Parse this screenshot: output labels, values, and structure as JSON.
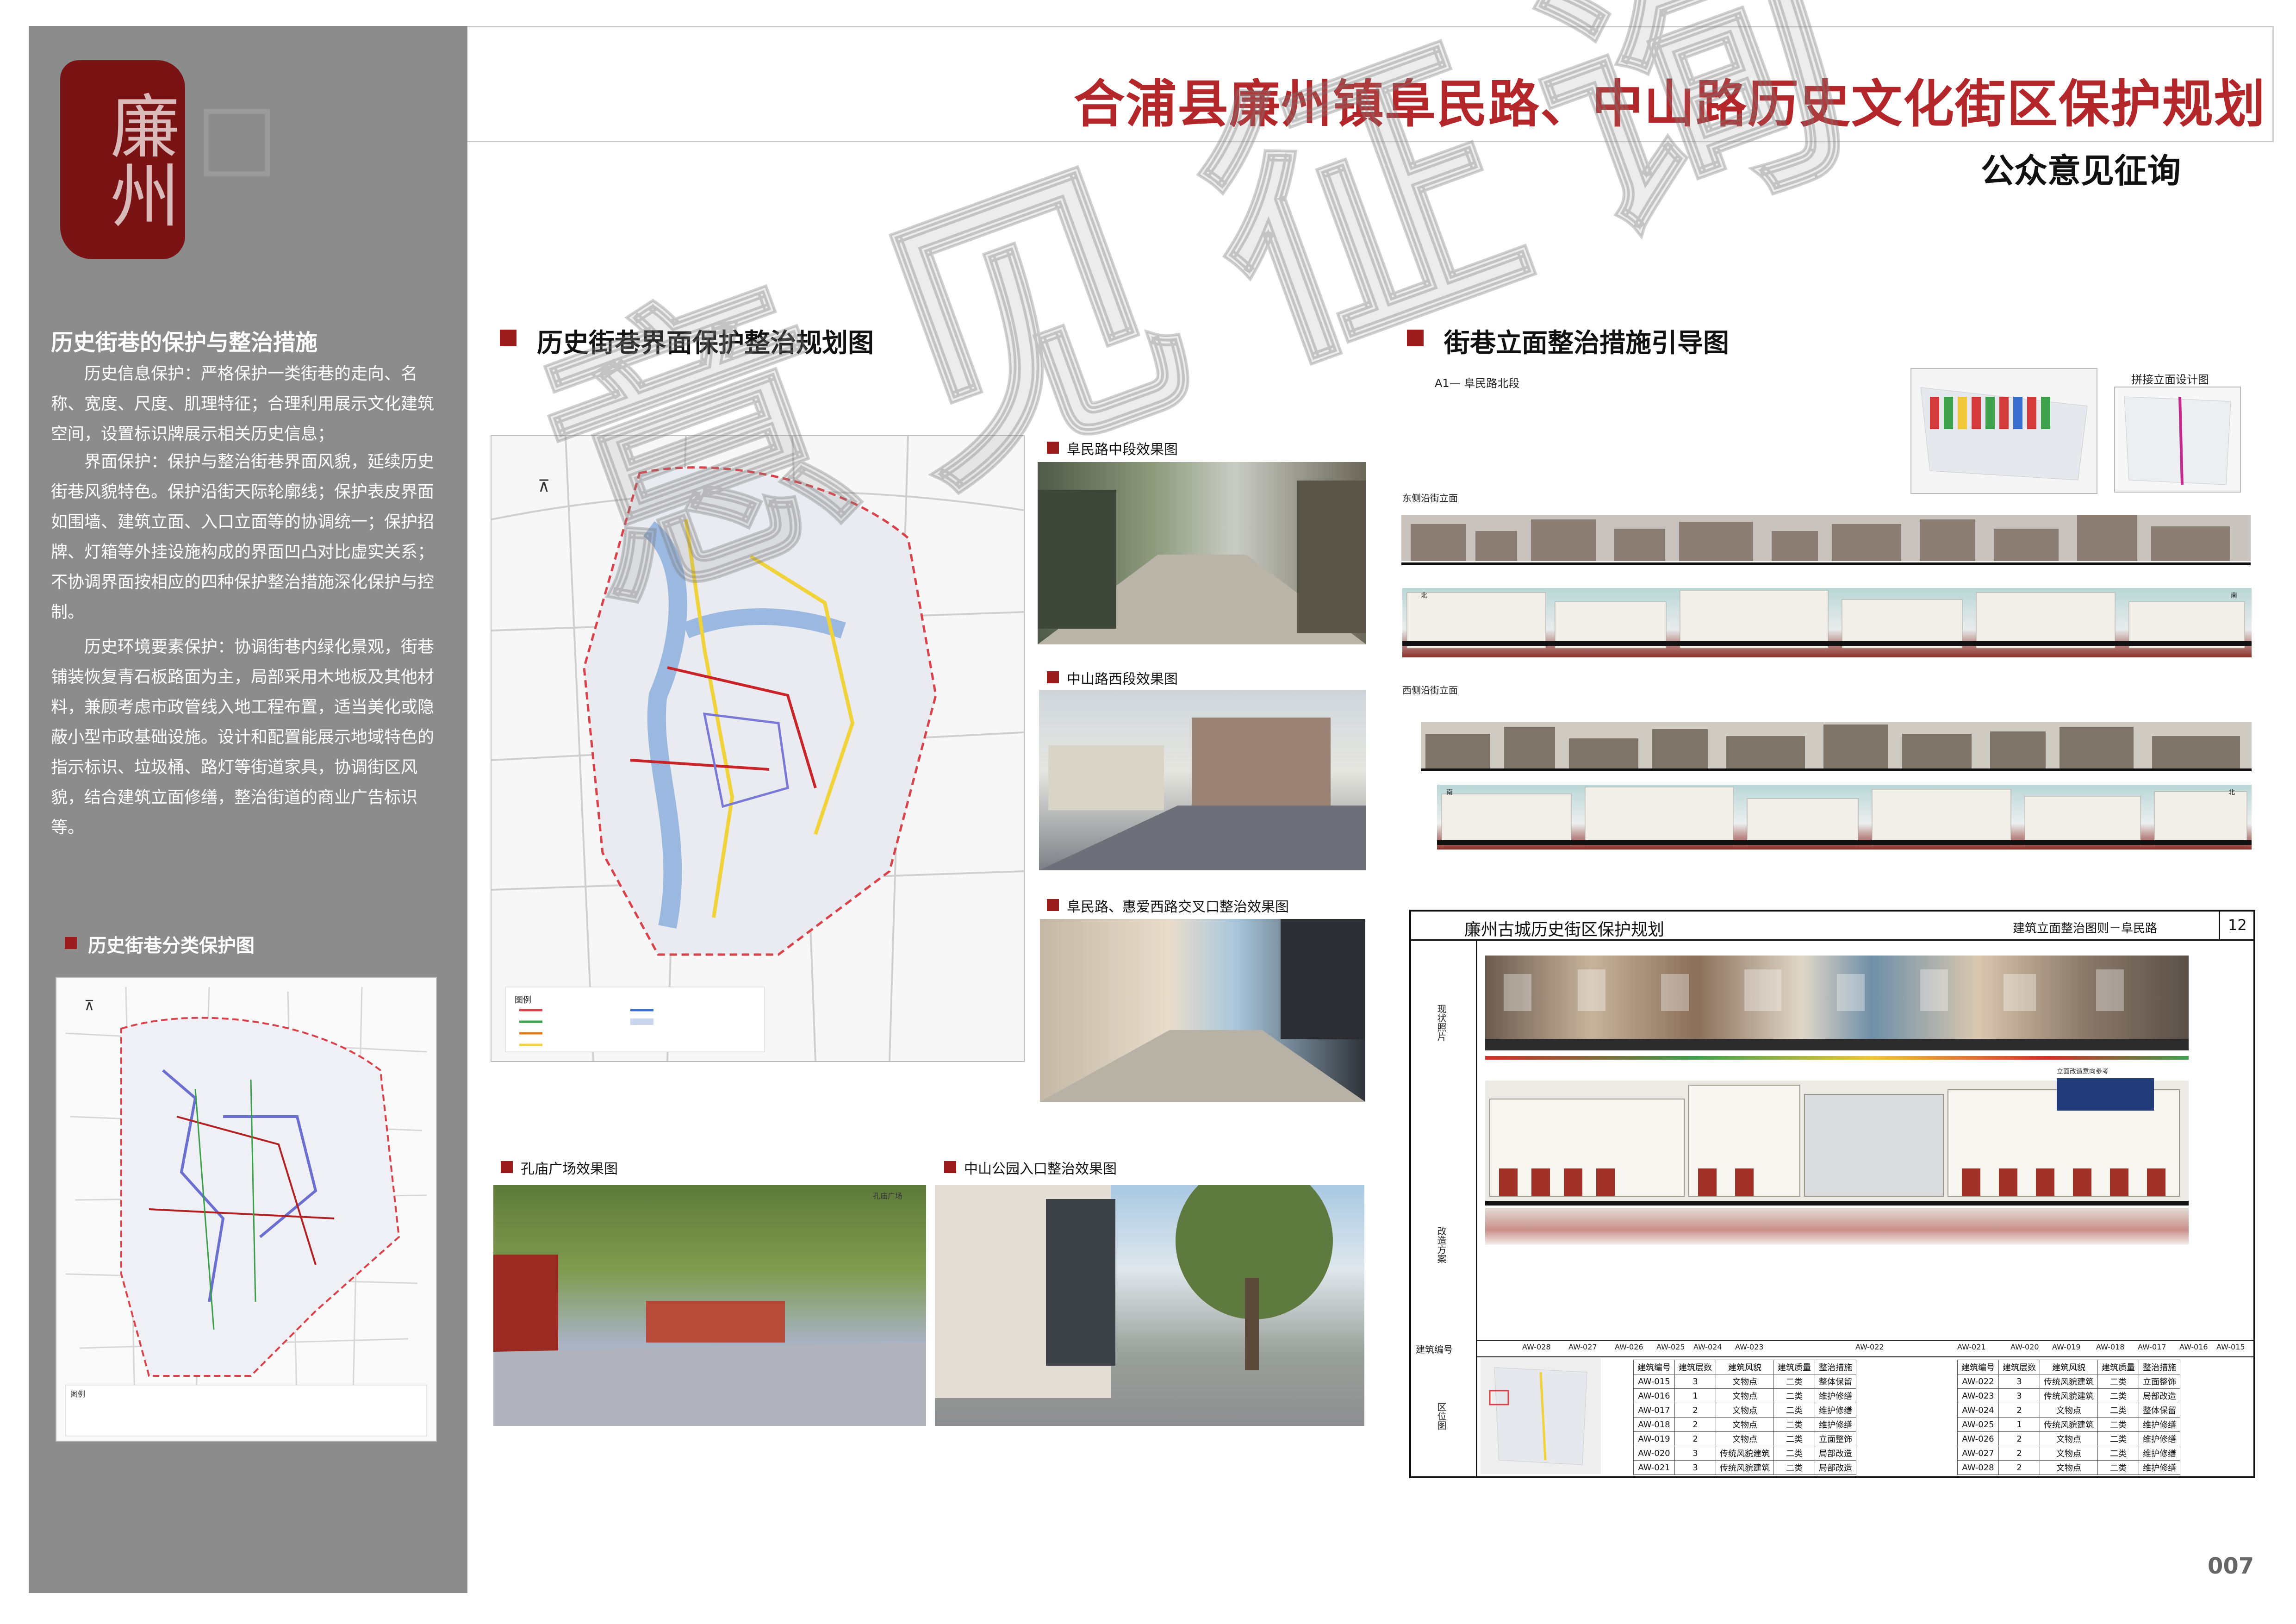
{
  "header": {
    "main_title": "合浦县廉州镇阜民路、中山路历史文化街区保护规划",
    "sub_title": "公众意见征询"
  },
  "sidebar": {
    "seal_text": "廉州",
    "heading": "历史街巷的保护与整治措施",
    "paragraphs": [
      "历史信息保护：严格保护一类街巷的走向、名称、宽度、尺度、肌理特征；合理利用展示文化建筑空间，设置标识牌展示相关历史信息；",
      "界面保护：保护与整治街巷界面风貌，延续历史街巷风貌特色。保护沿街天际轮廓线；保护表皮界面如围墙、建筑立面、入口立面等的协调统一；保护招牌、灯箱等外挂设施构成的界面凹凸对比虚实关系；不协调界面按相应的四种保护整治措施深化保护与控制。",
      "历史环境要素保护：协调街巷内绿化景观，街巷铺装恢复青石板路面为主，局部采用木地板及其他材料，兼顾考虑市政管线入地工程布置，适当美化或隐蔽小型市政基础设施。设计和配置能展示地域特色的指示标识、垃圾桶、路灯等街道家具，协调街区风貌，结合建筑立面修缮，整治街道的商业广告标识等。"
    ],
    "map_title": "历史街巷分类保护图",
    "map_legend_title": "图例"
  },
  "middle": {
    "section_title": "历史街巷界面保护整治规划图",
    "legend_title": "图例",
    "renders": [
      {
        "caption": "阜民路中段效果图"
      },
      {
        "caption": "中山路西段效果图"
      },
      {
        "caption": "阜民路、惠爱西路交叉口整治效果图"
      },
      {
        "caption": "孔庙广场效果图",
        "inset": "孔庙广场"
      },
      {
        "caption": "中山公园入口整治效果图"
      }
    ]
  },
  "right": {
    "section_title": "街巷立面整治措施引导图",
    "segment_label": "A1— 阜民路北段",
    "stitched_label": "拼接立面设计图",
    "east_label": "东侧沿街立面",
    "west_label": "西侧沿街立面",
    "dir_north": "北",
    "dir_south": "南",
    "sheet": {
      "title": "廉州古城历史街区保护规划",
      "subtitle": "建筑立面整治图则－阜民路",
      "number": "12",
      "row_labels": [
        "现状照片",
        "改造方案",
        "建筑编号",
        "区位图"
      ],
      "inset_label": "立面改造意向参考",
      "codes": [
        "AW-028",
        "AW-027",
        "AW-026",
        "AW-025",
        "AW-024",
        "AW-023",
        "AW-022",
        "AW-021",
        "AW-020",
        "AW-019",
        "AW-018",
        "AW-017",
        "AW-016",
        "AW-015"
      ],
      "table_headers": [
        "建筑编号",
        "建筑层数",
        "建筑风貌",
        "建筑质量",
        "整治措施"
      ],
      "table_left": [
        [
          "AW-015",
          "3",
          "文物点",
          "二类",
          "整体保留"
        ],
        [
          "AW-016",
          "1",
          "文物点",
          "二类",
          "维护修缮"
        ],
        [
          "AW-017",
          "2",
          "文物点",
          "二类",
          "维护修缮"
        ],
        [
          "AW-018",
          "2",
          "文物点",
          "二类",
          "维护修缮"
        ],
        [
          "AW-019",
          "2",
          "文物点",
          "二类",
          "立面整饰"
        ],
        [
          "AW-020",
          "3",
          "传统风貌建筑",
          "二类",
          "局部改造"
        ],
        [
          "AW-021",
          "3",
          "传统风貌建筑",
          "二类",
          "局部改造"
        ]
      ],
      "table_right": [
        [
          "AW-022",
          "3",
          "传统风貌建筑",
          "二类",
          "立面整饰"
        ],
        [
          "AW-023",
          "3",
          "传统风貌建筑",
          "二类",
          "局部改造"
        ],
        [
          "AW-024",
          "2",
          "文物点",
          "二类",
          "整体保留"
        ],
        [
          "AW-025",
          "1",
          "传统风貌建筑",
          "二类",
          "维护修缮"
        ],
        [
          "AW-026",
          "2",
          "文物点",
          "二类",
          "维护修缮"
        ],
        [
          "AW-027",
          "2",
          "文物点",
          "二类",
          "维护修缮"
        ],
        [
          "AW-028",
          "2",
          "文物点",
          "二类",
          "维护修缮"
        ]
      ]
    }
  },
  "watermark": "意见征询",
  "page_number": "007",
  "colors": {
    "title_red": "#b3262a",
    "sidebar_gray": "#8c8c8c",
    "seal_red": "#7a1414",
    "marker_red": "#9b1c1c"
  }
}
